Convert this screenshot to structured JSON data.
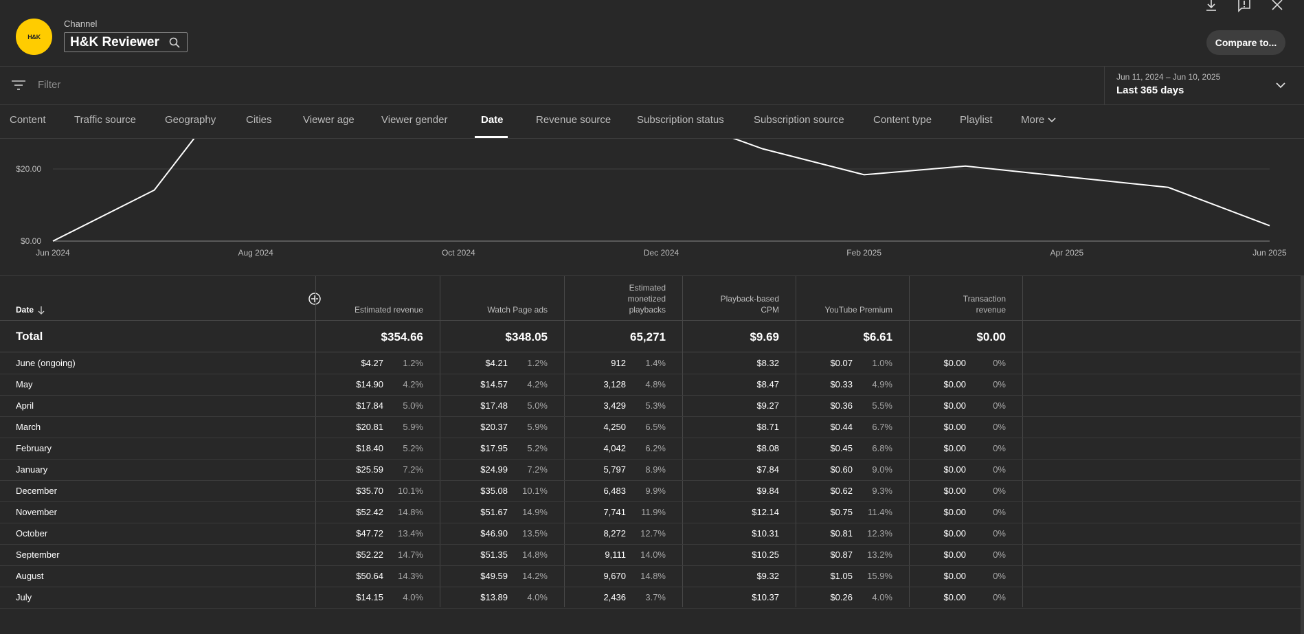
{
  "header": {
    "channel_label": "Channel",
    "channel_name": "H&K Reviewer",
    "logo_text": "H&K",
    "compare_label": "Compare to...",
    "icons": [
      "download-icon",
      "feedback-icon",
      "close-icon",
      "search-icon"
    ]
  },
  "filter": {
    "placeholder": "Filter",
    "date_range_small": "Jun 11, 2024 – Jun 10, 2025",
    "date_range_main": "Last 365 days"
  },
  "tabs": [
    {
      "label": "Content"
    },
    {
      "label": "Traffic source"
    },
    {
      "label": "Geography"
    },
    {
      "label": "Cities"
    },
    {
      "label": "Viewer age"
    },
    {
      "label": "Viewer gender"
    },
    {
      "label": "Date",
      "active": true
    },
    {
      "label": "Revenue source"
    },
    {
      "label": "Subscription status"
    },
    {
      "label": "Subscription source"
    },
    {
      "label": "Content type"
    },
    {
      "label": "Playlist"
    },
    {
      "label": "More"
    }
  ],
  "chart_data": {
    "type": "line",
    "x": [
      "Jun 2024",
      "Jul 2024",
      "Aug 2024",
      "Sep 2024",
      "Oct 2024",
      "Nov 2024",
      "Dec 2024",
      "Jan 2025",
      "Feb 2025",
      "Mar 2025",
      "Apr 2025",
      "May 2025",
      "Jun 2025"
    ],
    "y": [
      0.0,
      14.15,
      50.64,
      52.22,
      47.72,
      52.42,
      35.7,
      25.59,
      18.4,
      20.81,
      17.84,
      14.9,
      4.27
    ],
    "y_ticks": [
      "$0.00",
      "$20.00"
    ],
    "x_ticks": [
      "Jun 2024",
      "Aug 2024",
      "Oct 2024",
      "Dec 2024",
      "Feb 2025",
      "Apr 2025",
      "Jun 2025"
    ],
    "grid": true,
    "line_color": "#ffffff"
  },
  "table": {
    "date_header": "Date",
    "columns": [
      {
        "title": [
          "Estimated revenue"
        ],
        "total": "$354.66"
      },
      {
        "title": [
          "Watch Page ads"
        ],
        "total": "$348.05"
      },
      {
        "title": [
          "Estimated",
          "monetized",
          "playbacks"
        ],
        "total": "65,271"
      },
      {
        "title": [
          "Playback-based",
          "CPM"
        ],
        "total": "$9.69"
      },
      {
        "title": [
          "YouTube Premium"
        ],
        "total": "$6.61"
      },
      {
        "title": [
          "Transaction",
          "revenue"
        ],
        "total": "$0.00"
      }
    ],
    "total_label": "Total",
    "rows": [
      {
        "label": "June (ongoing)",
        "c": [
          [
            "$4.27",
            "1.2%"
          ],
          [
            "$4.21",
            "1.2%"
          ],
          [
            "912",
            "1.4%"
          ],
          [
            "$8.32",
            ""
          ],
          [
            "$0.07",
            "1.0%"
          ],
          [
            "$0.00",
            "0%"
          ]
        ]
      },
      {
        "label": "May",
        "c": [
          [
            "$14.90",
            "4.2%"
          ],
          [
            "$14.57",
            "4.2%"
          ],
          [
            "3,128",
            "4.8%"
          ],
          [
            "$8.47",
            ""
          ],
          [
            "$0.33",
            "4.9%"
          ],
          [
            "$0.00",
            "0%"
          ]
        ]
      },
      {
        "label": "April",
        "c": [
          [
            "$17.84",
            "5.0%"
          ],
          [
            "$17.48",
            "5.0%"
          ],
          [
            "3,429",
            "5.3%"
          ],
          [
            "$9.27",
            ""
          ],
          [
            "$0.36",
            "5.5%"
          ],
          [
            "$0.00",
            "0%"
          ]
        ]
      },
      {
        "label": "March",
        "c": [
          [
            "$20.81",
            "5.9%"
          ],
          [
            "$20.37",
            "5.9%"
          ],
          [
            "4,250",
            "6.5%"
          ],
          [
            "$8.71",
            ""
          ],
          [
            "$0.44",
            "6.7%"
          ],
          [
            "$0.00",
            "0%"
          ]
        ]
      },
      {
        "label": "February",
        "c": [
          [
            "$18.40",
            "5.2%"
          ],
          [
            "$17.95",
            "5.2%"
          ],
          [
            "4,042",
            "6.2%"
          ],
          [
            "$8.08",
            ""
          ],
          [
            "$0.45",
            "6.8%"
          ],
          [
            "$0.00",
            "0%"
          ]
        ]
      },
      {
        "label": "January",
        "c": [
          [
            "$25.59",
            "7.2%"
          ],
          [
            "$24.99",
            "7.2%"
          ],
          [
            "5,797",
            "8.9%"
          ],
          [
            "$7.84",
            ""
          ],
          [
            "$0.60",
            "9.0%"
          ],
          [
            "$0.00",
            "0%"
          ]
        ]
      },
      {
        "label": "December",
        "c": [
          [
            "$35.70",
            "10.1%"
          ],
          [
            "$35.08",
            "10.1%"
          ],
          [
            "6,483",
            "9.9%"
          ],
          [
            "$9.84",
            ""
          ],
          [
            "$0.62",
            "9.3%"
          ],
          [
            "$0.00",
            "0%"
          ]
        ]
      },
      {
        "label": "November",
        "c": [
          [
            "$52.42",
            "14.8%"
          ],
          [
            "$51.67",
            "14.9%"
          ],
          [
            "7,741",
            "11.9%"
          ],
          [
            "$12.14",
            ""
          ],
          [
            "$0.75",
            "11.4%"
          ],
          [
            "$0.00",
            "0%"
          ]
        ]
      },
      {
        "label": "October",
        "c": [
          [
            "$47.72",
            "13.4%"
          ],
          [
            "$46.90",
            "13.5%"
          ],
          [
            "8,272",
            "12.7%"
          ],
          [
            "$10.31",
            ""
          ],
          [
            "$0.81",
            "12.3%"
          ],
          [
            "$0.00",
            "0%"
          ]
        ]
      },
      {
        "label": "September",
        "c": [
          [
            "$52.22",
            "14.7%"
          ],
          [
            "$51.35",
            "14.8%"
          ],
          [
            "9,111",
            "14.0%"
          ],
          [
            "$10.25",
            ""
          ],
          [
            "$0.87",
            "13.2%"
          ],
          [
            "$0.00",
            "0%"
          ]
        ]
      },
      {
        "label": "August",
        "c": [
          [
            "$50.64",
            "14.3%"
          ],
          [
            "$49.59",
            "14.2%"
          ],
          [
            "9,670",
            "14.8%"
          ],
          [
            "$9.32",
            ""
          ],
          [
            "$1.05",
            "15.9%"
          ],
          [
            "$0.00",
            "0%"
          ]
        ]
      },
      {
        "label": "July",
        "c": [
          [
            "$14.15",
            "4.0%"
          ],
          [
            "$13.89",
            "4.0%"
          ],
          [
            "2,436",
            "3.7%"
          ],
          [
            "$10.37",
            ""
          ],
          [
            "$0.26",
            "4.0%"
          ],
          [
            "$0.00",
            "0%"
          ]
        ]
      }
    ]
  }
}
